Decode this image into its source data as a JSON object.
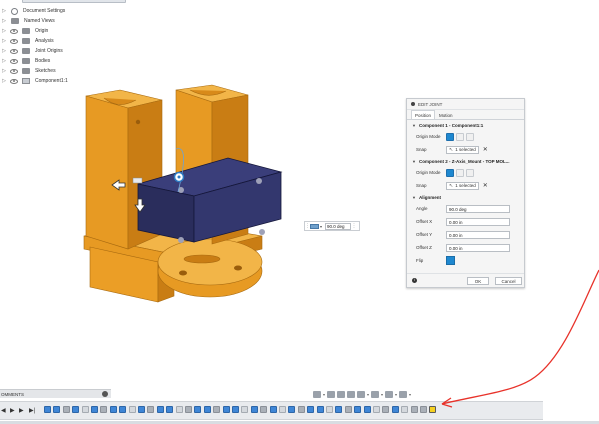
{
  "browser": {
    "top_item": "",
    "items": [
      {
        "label": "Document Settings",
        "icon": "gear-icon"
      },
      {
        "label": "Named Views",
        "icon": "folder-icon"
      },
      {
        "label": "Origin",
        "icon": "folder-icon"
      },
      {
        "label": "Analysis",
        "icon": "folder-icon"
      },
      {
        "label": "Joint Origins",
        "icon": "folder-icon"
      },
      {
        "label": "Bodies",
        "icon": "folder-icon"
      },
      {
        "label": "Sketches",
        "icon": "folder-icon"
      },
      {
        "label": "Component1:1",
        "icon": "component-icon"
      }
    ]
  },
  "angle_input": {
    "value": "90.0 deg"
  },
  "edit_joint": {
    "title": "EDIT JOINT",
    "tabs": [
      "Position",
      "Motion"
    ],
    "component1": {
      "title": "Component 1 - Component1:1",
      "origin_mode_label": "Origin Mode",
      "snap_label": "Snap",
      "snap_value": "1 selected"
    },
    "component2": {
      "title": "Component 2 - Z-Axis_Mount - TOP MOL...",
      "origin_mode_label": "Origin Mode",
      "snap_label": "Snap",
      "snap_value": "1 selected"
    },
    "alignment": {
      "title": "Alignment",
      "angle_label": "Angle",
      "angle_value": "90.0 deg",
      "offset_x_label": "Offset X",
      "offset_x_value": "0.00 in",
      "offset_y_label": "Offset Y",
      "offset_y_value": "0.00 in",
      "offset_z_label": "Offset Z",
      "offset_z_value": "0.00 in",
      "flip_label": "Flip"
    },
    "ok_label": "OK",
    "cancel_label": "Cancel"
  },
  "comments": {
    "label": "OMMENTS"
  },
  "colors": {
    "accent": "#1e88d0",
    "body_orange": "#f0a42a",
    "body_navy": "#2d3068",
    "annotation_red": "#e8322a",
    "joint_highlight": "#f5d020"
  }
}
